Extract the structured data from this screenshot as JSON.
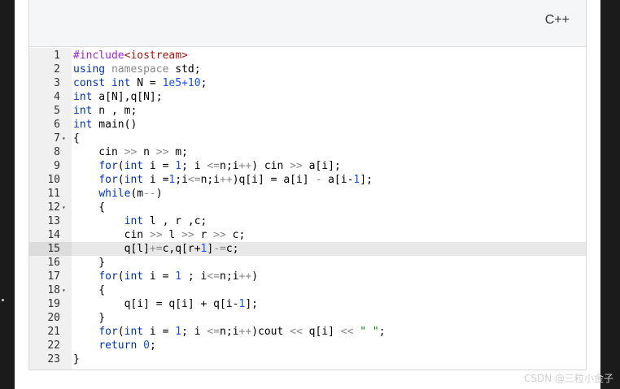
{
  "header": {
    "language": "C++"
  },
  "watermark": "CSDN @三粒小金子",
  "active_line": 15,
  "fold_lines": [
    7,
    12,
    18
  ],
  "lines": [
    {
      "n": "1",
      "html": "<span class='pp'>#include</span><span class='inc'>&lt;iostream&gt;</span>"
    },
    {
      "n": "2",
      "html": "<span class='kw'>using</span> <span class='op'>namespace</span> std;"
    },
    {
      "n": "3",
      "html": "<span class='kw'>const</span> <span class='ty'>int</span> N = <span class='num'>1e5+10</span>;"
    },
    {
      "n": "4",
      "html": "<span class='ty'>int</span> a[N],q[N];"
    },
    {
      "n": "5",
      "html": "<span class='ty'>int</span> n , m;"
    },
    {
      "n": "6",
      "html": "<span class='ty'>int</span> main()"
    },
    {
      "n": "7",
      "html": "{"
    },
    {
      "n": "8",
      "html": "    cin <span class='op'>&gt;&gt;</span> n <span class='op'>&gt;&gt;</span> m;"
    },
    {
      "n": "9",
      "html": "    <span class='kw'>for</span>(<span class='ty'>int</span> i = <span class='num'>1</span>; i <span class='op'>&lt;=</span>n;i<span class='op'>++</span>) cin <span class='op'>&gt;&gt;</span> a[i];"
    },
    {
      "n": "10",
      "html": "    <span class='kw'>for</span>(<span class='ty'>int</span> i =<span class='num'>1</span>;i<span class='op'>&lt;=</span>n;i<span class='op'>++</span>)q[i] = a[i] <span class='op'>-</span> a[i-<span class='num'>1</span>];"
    },
    {
      "n": "11",
      "html": "    <span class='kw'>while</span>(m<span class='op'>--</span>)"
    },
    {
      "n": "12",
      "html": "    {"
    },
    {
      "n": "13",
      "html": "        <span class='ty'>int</span> l , r ,c;"
    },
    {
      "n": "14",
      "html": "        cin <span class='op'>&gt;&gt;</span> l <span class='op'>&gt;&gt;</span> r <span class='op'>&gt;&gt;</span> c;"
    },
    {
      "n": "15",
      "html": "        q[l]<span class='op'>+=</span>c,q[r+<span class='num'>1</span>]<span class='op'>-=</span>c;"
    },
    {
      "n": "16",
      "html": "    }"
    },
    {
      "n": "17",
      "html": "    <span class='kw'>for</span>(<span class='ty'>int</span> i = <span class='num'>1</span> ; i<span class='op'>&lt;=</span>n;i<span class='op'>++</span>)"
    },
    {
      "n": "18",
      "html": "    {"
    },
    {
      "n": "19",
      "html": "        q[i] = q[i] + q[i-<span class='num'>1</span>];"
    },
    {
      "n": "20",
      "html": "    }"
    },
    {
      "n": "21",
      "html": "    <span class='kw'>for</span>(<span class='ty'>int</span> i = <span class='num'>1</span>; i <span class='op'>&lt;=</span>n;i<span class='op'>++</span>)cout <span class='op'>&lt;&lt;</span> q[i] <span class='op'>&lt;&lt;</span> <span class='str'>\" \"</span>;"
    },
    {
      "n": "22",
      "html": "    <span class='kw'>return</span> <span class='num'>0</span>;"
    },
    {
      "n": "23",
      "html": "}"
    }
  ]
}
